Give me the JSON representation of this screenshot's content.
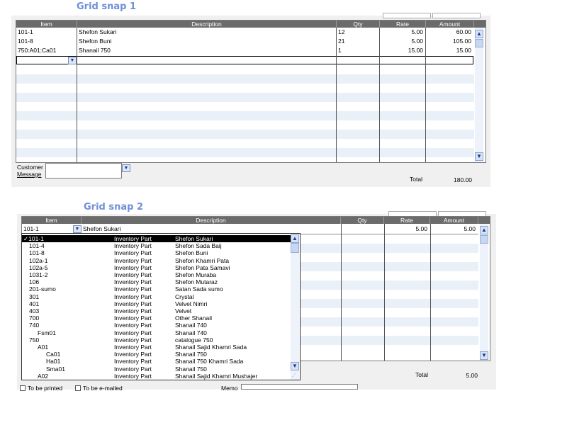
{
  "snap1": {
    "title": "Grid snap 1",
    "headers": {
      "item": "Item",
      "description": "Description",
      "qty": "Qty",
      "rate": "Rate",
      "amount": "Amount"
    },
    "rows": [
      {
        "item": "101-1",
        "description": "Shefon Sukari",
        "qty": "12",
        "rate": "5.00",
        "amount": "60.00"
      },
      {
        "item": "101-8",
        "description": "Shefon Buni",
        "qty": "21",
        "rate": "5.00",
        "amount": "105.00"
      },
      {
        "item": "750:A01:Ca01",
        "description": "Shanail 750",
        "qty": "1",
        "rate": "15.00",
        "amount": "15.00"
      }
    ],
    "customer_message_line1": "Customer",
    "customer_message_line2": "Message",
    "total_label": "Total",
    "total_value": "180.00"
  },
  "snap2": {
    "title": "Grid snap 2",
    "headers": {
      "item": "Item",
      "description": "Description",
      "qty": "Qty",
      "rate": "Rate",
      "amount": "Amount"
    },
    "edit_row": {
      "item": "101-1",
      "description": "Shefon Sukari",
      "rate": "5.00",
      "amount": "5.00"
    },
    "dropdown": [
      {
        "code": "✓101-1",
        "type": "Inventory Part",
        "name": "Shefon Sukari",
        "indent": 0,
        "selected": true
      },
      {
        "code": "101-4",
        "type": "Inventory Part",
        "name": "Shefon Sada Baij",
        "indent": 1
      },
      {
        "code": "101-8",
        "type": "Inventory Part",
        "name": "Shefon Buni",
        "indent": 1
      },
      {
        "code": "102a-1",
        "type": "Inventory Part",
        "name": "Shefon Khamri Pata",
        "indent": 1
      },
      {
        "code": "102a-5",
        "type": "Inventory Part",
        "name": "Shefon Pata Samavi",
        "indent": 1
      },
      {
        "code": "1031-2",
        "type": "Inventory Part",
        "name": "Shefon Muraba",
        "indent": 1
      },
      {
        "code": "106",
        "type": "Inventory Part",
        "name": "Shefon Mutaraz",
        "indent": 1
      },
      {
        "code": "201-sumo",
        "type": "Inventory Part",
        "name": "Satan Sada sumo",
        "indent": 1
      },
      {
        "code": "301",
        "type": "Inventory Part",
        "name": "Crystal",
        "indent": 1
      },
      {
        "code": "401",
        "type": "Inventory Part",
        "name": "Velvet Nimri",
        "indent": 1
      },
      {
        "code": "403",
        "type": "Inventory Part",
        "name": "Velvet",
        "indent": 1
      },
      {
        "code": "700",
        "type": "Inventory Part",
        "name": "Other Shanail",
        "indent": 1
      },
      {
        "code": "740",
        "type": "Inventory Part",
        "name": "Shanail 740",
        "indent": 1
      },
      {
        "code": "Fsm01",
        "type": "Inventory Part",
        "name": "Shanail 740",
        "indent": 2
      },
      {
        "code": "750",
        "type": "Inventory Part",
        "name": "catalogue 750",
        "indent": 1
      },
      {
        "code": "A01",
        "type": "Inventory Part",
        "name": "Shanail Sajid Khamri Sada",
        "indent": 2
      },
      {
        "code": "Ca01",
        "type": "Inventory Part",
        "name": "Shanail 750",
        "indent": 3
      },
      {
        "code": "Ha01",
        "type": "Inventory Part",
        "name": "Shanail 750 Khamri Sada",
        "indent": 3
      },
      {
        "code": "Sma01",
        "type": "Inventory Part",
        "name": "Shanail 750",
        "indent": 3
      },
      {
        "code": "A02",
        "type": "Inventory Part",
        "name": "Shanail Sajid Khamri Mushajer",
        "indent": 2
      }
    ],
    "total_label": "Total",
    "total_value": "5.00",
    "to_be_printed": "To be printed",
    "to_be_emailed": "To be e-mailed",
    "memo_label": "Memo"
  }
}
